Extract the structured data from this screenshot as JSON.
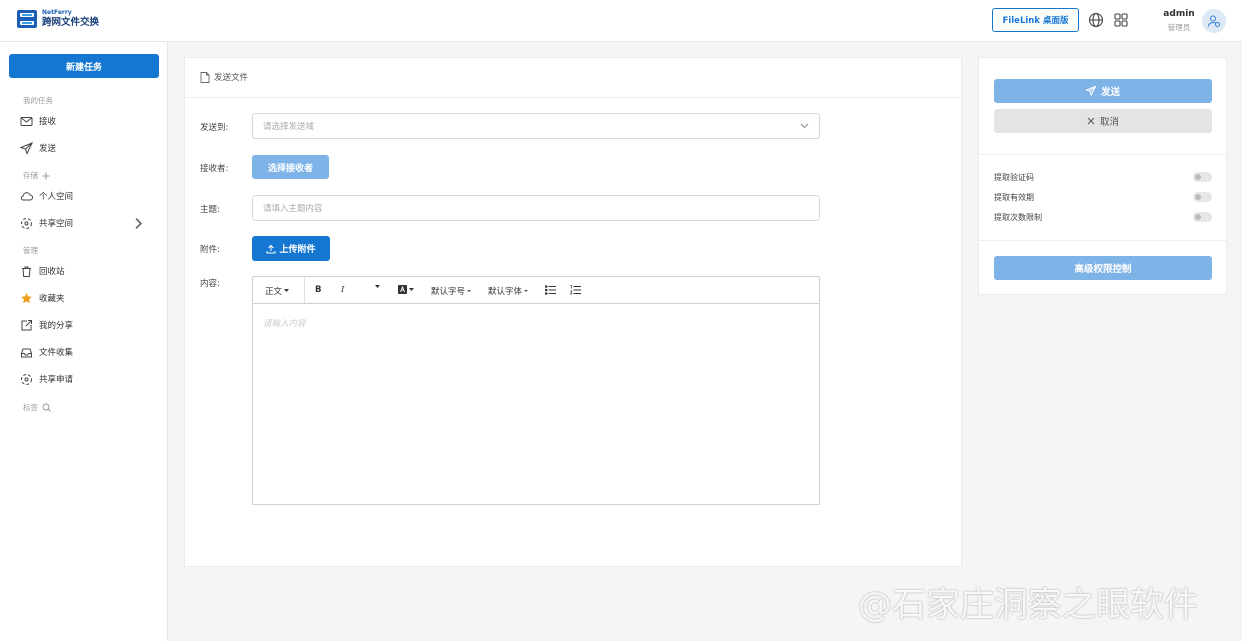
{
  "header": {
    "logo_en": "NetFerry",
    "logo_cn": "跨网文件交换",
    "filelink_label": "FileLink 桌面版",
    "user_name": "admin",
    "user_role": "管理员"
  },
  "sidebar": {
    "new_task": "新建任务",
    "sections": {
      "my_tasks": "我的任务",
      "storage": "存储",
      "manage": "管理",
      "tags": "标签"
    },
    "items": [
      {
        "label": "接收",
        "icon": "mail-icon"
      },
      {
        "label": "发送",
        "icon": "send-icon"
      },
      {
        "label": "个人空间",
        "icon": "cloud-icon"
      },
      {
        "label": "共享空间",
        "icon": "share-space-icon"
      },
      {
        "label": "回收站",
        "icon": "trash-icon"
      },
      {
        "label": "收藏夹",
        "icon": "star-icon"
      },
      {
        "label": "我的分享",
        "icon": "my-share-icon"
      },
      {
        "label": "文件收集",
        "icon": "inbox-icon"
      },
      {
        "label": "共享申请",
        "icon": "share-request-icon"
      }
    ]
  },
  "main": {
    "title": "发送文件",
    "send_to_label": "发送到:",
    "send_to_placeholder": "请选择发送域",
    "recipient_label": "接收者:",
    "recipient_button": "选择接收者",
    "subject_label": "主题:",
    "subject_placeholder": "请填入主题内容",
    "attachment_label": "附件:",
    "upload_button": "上传附件",
    "content_label": "内容:",
    "editor": {
      "paragraph": "正文",
      "bold": "B",
      "italic": "I",
      "font_size": "默认字号",
      "font_family": "默认字体",
      "placeholder": "请输入内容"
    }
  },
  "right_panel": {
    "send_button": "发送",
    "cancel_button": "取消",
    "options": [
      {
        "label": "提取验证码",
        "enabled": false
      },
      {
        "label": "提取有效期",
        "enabled": false
      },
      {
        "label": "提取次数限制",
        "enabled": false
      }
    ],
    "advanced_button": "高级权限控制"
  },
  "watermark": "@石家庄洞察之眼软件",
  "colors": {
    "primary": "#1677d2",
    "primary_light": "#7db3e6",
    "star": "#f0a020"
  }
}
